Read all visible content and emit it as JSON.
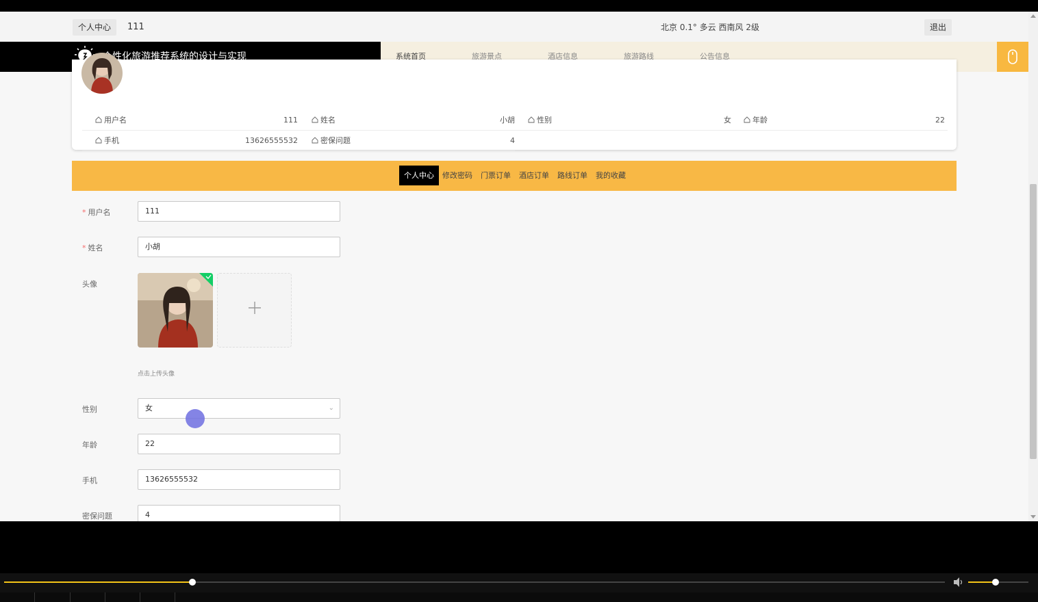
{
  "topbar": {
    "center_label": "个人中心",
    "username": "111",
    "weather": "北京  0.1°  多云  西南风  2级",
    "logout": "退出"
  },
  "navbar": {
    "title": "个性化旅游推荐系统的设计与实现",
    "menu": [
      "系统首页",
      "旅游景点",
      "酒店信息",
      "旅游路线",
      "公告信息"
    ]
  },
  "profile": {
    "rows": [
      [
        {
          "label": "用户名",
          "value": "111"
        },
        {
          "label": "姓名",
          "value": "小胡"
        },
        {
          "label": "性别",
          "value": "女"
        },
        {
          "label": "年龄",
          "value": "22"
        }
      ],
      [
        {
          "label": "手机",
          "value": "13626555532"
        },
        {
          "label": "密保问题",
          "value": "4"
        }
      ]
    ]
  },
  "tabs": [
    "个人中心",
    "修改密码",
    "门票订单",
    "酒店订单",
    "路线订单",
    "我的收藏"
  ],
  "form": {
    "username": {
      "label": "用户名",
      "value": "111"
    },
    "name": {
      "label": "姓名",
      "value": "小胡"
    },
    "avatar": {
      "label": "头像",
      "hint": "点击上传头像"
    },
    "gender": {
      "label": "性别",
      "value": "女"
    },
    "age": {
      "label": "年龄",
      "value": "22"
    },
    "phone": {
      "label": "手机",
      "value": "13626555532"
    },
    "question": {
      "label": "密保问题",
      "value": "4"
    }
  },
  "player": {
    "progress": 0.2,
    "volume": 0.45
  }
}
